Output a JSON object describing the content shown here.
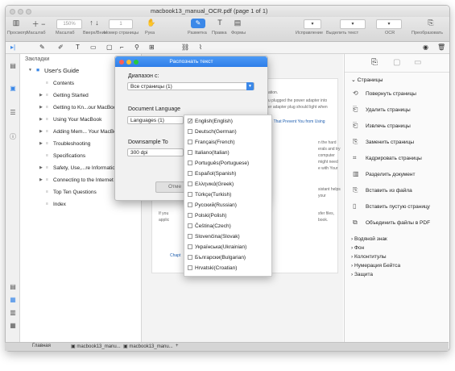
{
  "window": {
    "title": "macbook13_manual_OCR.pdf (page 1 of 1)"
  },
  "toolbar": {
    "labels": [
      "Просмотр",
      "Масштаб",
      "Масштаб",
      "Вверх/Вниз",
      "Номер страницы",
      "Рука",
      "Разметка",
      "Правка",
      "Формы",
      "Исправление",
      "Выделить текст",
      "OCR",
      "Преобразовать"
    ],
    "zoom_value": "150%",
    "page_value": "1"
  },
  "bookmarks": {
    "header": "Закладки",
    "root": "User's Guide",
    "items": [
      "Contents",
      "Getting Started",
      "Getting to Kn...our MacBook",
      "Using Your MacBook",
      "Adding Mem... Your MacBook",
      "Troubleshooting",
      "Specifications",
      "Safety, Use,...re Information",
      "Connecting to the Internet",
      "Top Ten Questions",
      "Index"
    ]
  },
  "dialog": {
    "title": "Распознать текст",
    "range_label": "Диапазон с:",
    "range_value": "Все страницы (1)",
    "lang_label": "Document Language",
    "lang_value": "Languages (1)",
    "downsample_label": "Downsample To",
    "downsample_value": "300 dpi",
    "cancel_label": "Отме"
  },
  "languages": [
    {
      "label": "English(English)",
      "checked": true
    },
    {
      "label": "Deutsch(German)",
      "checked": false
    },
    {
      "label": "Français(French)",
      "checked": false
    },
    {
      "label": "Italiano(Italian)",
      "checked": false
    },
    {
      "label": "Português(Portuguese)",
      "checked": false
    },
    {
      "label": "Español(Spanish)",
      "checked": false
    },
    {
      "label": "Ελληνικά(Greek)",
      "checked": false
    },
    {
      "label": "Türkçe(Turkish)",
      "checked": false
    },
    {
      "label": "Русский(Russian)",
      "checked": false
    },
    {
      "label": "Polski(Polish)",
      "checked": false
    },
    {
      "label": "Čeština(Czech)",
      "checked": false
    },
    {
      "label": "Slovenčina(Slovak)",
      "checked": false
    },
    {
      "label": "Українська(Ukrainian)",
      "checked": false
    },
    {
      "label": "Български(Bulgarian)",
      "checked": false
    },
    {
      "label": "Hrvatski(Croatian)",
      "checked": false
    }
  ],
  "doc_text": [
    "ation.",
    "u plugged the power adapter into",
    "er adapter plug should light when",
    "ns That Prevent You from Using",
    "n the hard",
    "erals and try",
    "computer",
    "might need",
    "e with Your",
    "sistant helps",
    "your",
    "If you",
    "sfer files,",
    "applic",
    "book.",
    "Chapt"
  ],
  "rightpanel": {
    "section": "Страницы",
    "items": [
      "Повернуть страницы",
      "Удалить страницы",
      "Извлечь страницы",
      "Заменить страницы",
      "Кадрировать страницы",
      "Разделить документ",
      "Вставить из файла",
      "Вставить пустую страницу",
      "Объединить файлы в PDF"
    ],
    "subsections": [
      "Водяной знак",
      "Фон",
      "Колонтитулы",
      "Нумерация Бейтса",
      "Защита"
    ]
  },
  "tabs": [
    "Главная",
    "macbook13_manu...",
    "macbook13_manu...",
    "+"
  ]
}
